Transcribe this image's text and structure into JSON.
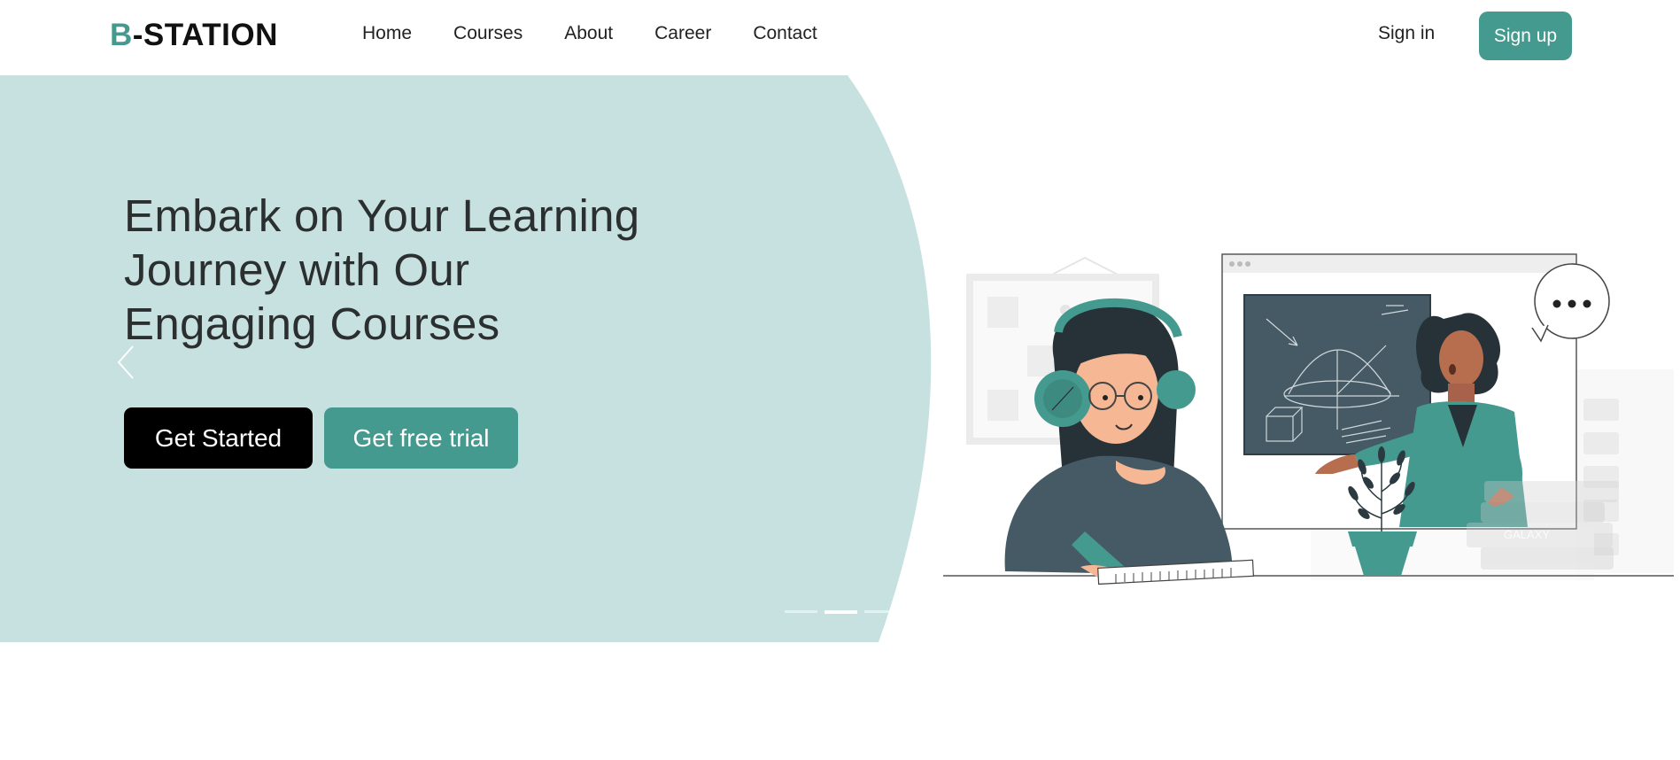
{
  "brand": {
    "logo_accent": "B",
    "logo_rest": "-STATION"
  },
  "nav": {
    "items": [
      {
        "label": "Home"
      },
      {
        "label": "Courses"
      },
      {
        "label": "About"
      },
      {
        "label": "Career"
      },
      {
        "label": "Contact"
      }
    ],
    "signin_label": "Sign in",
    "signup_label": "Sign up"
  },
  "hero": {
    "headline_line1": "Embark on Your Learning",
    "headline_line2": "Journey with Our",
    "headline_line3": "Engaging Courses",
    "primary_cta": "Get Started",
    "secondary_cta": "Get free trial",
    "carousel": {
      "slide_count": 3,
      "active_slide": 2
    }
  },
  "illustration": {
    "board_text": "GALAXY"
  },
  "colors": {
    "accent": "#459a8f",
    "hero_bg": "#c6e1df",
    "text_dark": "#2b2f30",
    "button_dark": "#000000"
  }
}
